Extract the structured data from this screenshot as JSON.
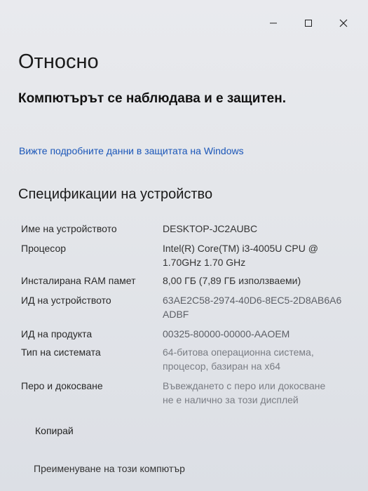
{
  "window": {
    "controls": {
      "minimize_icon": "minimize-icon",
      "maximize_icon": "maximize-icon",
      "close_icon": "close-icon"
    }
  },
  "page": {
    "title": "Относно",
    "protection_status": "Компютърът се наблюдава и е защитен.",
    "security_link": "Вижте подробните данни в защитата на Windows"
  },
  "specs": {
    "section_title": "Спецификации на устройство",
    "rows": [
      {
        "label": "Име на устройството",
        "value": "DESKTOP-JC2AUBC"
      },
      {
        "label": "Процесор",
        "value_line1": "Intel(R) Core(TM) i3-4005U CPU @",
        "value_line2": "1.70GHz   1.70 GHz"
      },
      {
        "label": "Инсталирана RAM памет",
        "value": "8,00 ГБ (7,89 ГБ използваеми)"
      },
      {
        "label": "ИД на устройството",
        "value_line1": "63AE2C58-2974-40D6-8EC5-2D8AB6A6",
        "value_line2": "ADBF"
      },
      {
        "label": "ИД на продукта",
        "value": "00325-80000-00000-AAOEM"
      },
      {
        "label": "Тип на системата",
        "value_line1": "64-битова операционна система,",
        "value_line2": "процесор, базиран на x64"
      },
      {
        "label": "Перо и докосване",
        "value_line1": "Въвеждането с перо или докосване",
        "value_line2": "не е налично за този дисплей"
      }
    ],
    "copy_label": "Копирай"
  },
  "footer": {
    "rename_label": "Преименуване на този компютър"
  }
}
